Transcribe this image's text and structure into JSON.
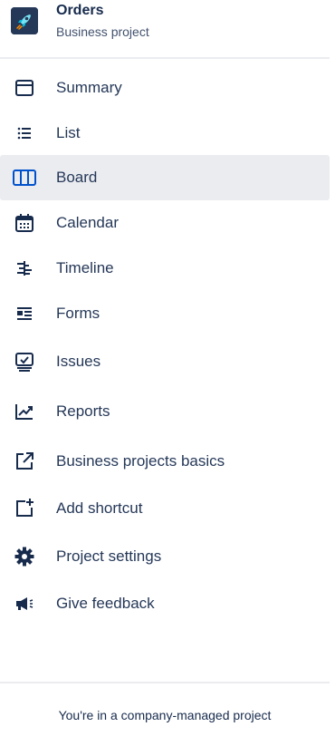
{
  "header": {
    "project_name": "Orders",
    "project_type": "Business project",
    "avatar_icon": "rocket-icon"
  },
  "nav": {
    "items": [
      {
        "label": "Summary",
        "icon": "summary-icon"
      },
      {
        "label": "List",
        "icon": "list-icon"
      },
      {
        "label": "Board",
        "icon": "board-icon",
        "selected": true
      },
      {
        "label": "Calendar",
        "icon": "calendar-icon"
      },
      {
        "label": "Timeline",
        "icon": "timeline-icon"
      },
      {
        "label": "Forms",
        "icon": "forms-icon"
      },
      {
        "label": "Issues",
        "icon": "issues-icon"
      },
      {
        "label": "Reports",
        "icon": "reports-icon"
      },
      {
        "label": "Business projects basics",
        "icon": "external-link-icon"
      },
      {
        "label": "Add shortcut",
        "icon": "add-shortcut-icon"
      },
      {
        "label": "Project settings",
        "icon": "settings-gear-icon"
      },
      {
        "label": "Give feedback",
        "icon": "megaphone-icon"
      }
    ]
  },
  "footer": {
    "text": "You're in a company-managed project"
  },
  "colors": {
    "text": "#172b4d",
    "selected_bg": "#ebecf0",
    "selected_icon": "#0052cc",
    "avatar_bg": "#253858"
  }
}
